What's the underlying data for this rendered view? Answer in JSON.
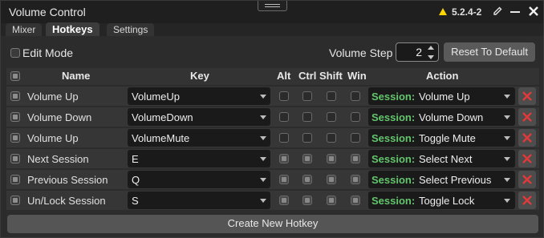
{
  "window": {
    "title": "Volume Control",
    "version": "5.2.4-2"
  },
  "tabs": [
    {
      "label": "Mixer",
      "active": false
    },
    {
      "label": "Hotkeys",
      "active": true
    },
    {
      "label": "Settings",
      "active": false
    }
  ],
  "toolbar": {
    "edit_mode_label": "Edit Mode",
    "volume_step_label": "Volume Step",
    "volume_step_value": "2",
    "reset_label": "Reset To Default"
  },
  "table": {
    "headers": {
      "name": "Name",
      "key": "Key",
      "alt": "Alt",
      "ctrl": "Ctrl",
      "shift": "Shift",
      "win": "Win",
      "action": "Action"
    },
    "session_prefix": "Session:",
    "rows": [
      {
        "name": "Volume Up",
        "key": "VolumeUp",
        "action": "Volume Up"
      },
      {
        "name": "Volume Down",
        "key": "VolumeDown",
        "action": "Volume Down"
      },
      {
        "name": "Volume Up",
        "key": "VolumeMute",
        "action": "Toggle Mute"
      },
      {
        "name": "Next Session",
        "key": "E",
        "action": "Select Next"
      },
      {
        "name": "Previous Session",
        "key": "Q",
        "action": "Select Previous"
      },
      {
        "name": "Un/Lock Session",
        "key": "S",
        "action": "Toggle Lock"
      }
    ]
  },
  "create_label": "Create New Hotkey",
  "colors": {
    "session_prefix": "#63c56c",
    "delete_x": "#e03a3a",
    "warning": "#ffd400"
  },
  "icons": [
    "warning-icon",
    "pencil-icon",
    "minimize-icon",
    "close-icon",
    "chevron-down-icon",
    "delete-icon"
  ]
}
